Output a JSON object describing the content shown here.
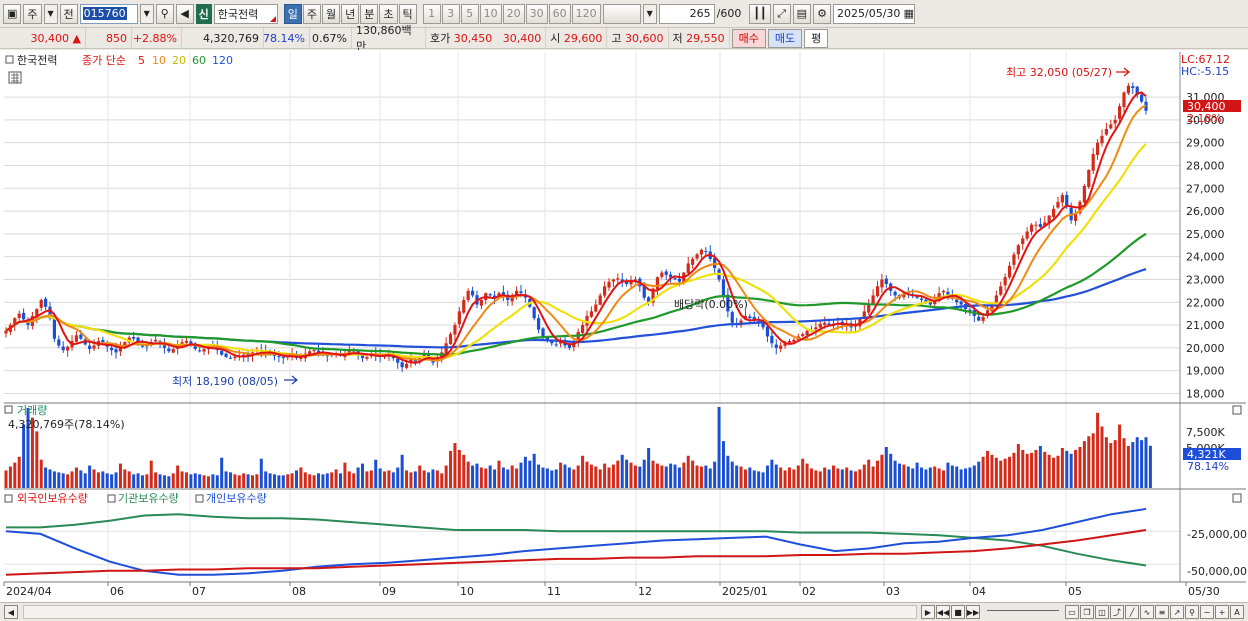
{
  "toolbar": {
    "period_main": "주",
    "market": "전",
    "code": "015760",
    "new_badge": "신",
    "stock_name": "한국전력",
    "periods": [
      "일",
      "주",
      "월",
      "년",
      "분",
      "초",
      "틱"
    ],
    "intervals": [
      "1",
      "3",
      "5",
      "10",
      "20",
      "30",
      "60",
      "120"
    ],
    "count": "265",
    "count_max": "/600",
    "date": "2025/05/30"
  },
  "quote": {
    "price": "30,400",
    "arrow": "▲",
    "change": "850",
    "change_pct": "+2.88%",
    "volume": "4,320,769",
    "volume_ratio": "78.14%",
    "turnover": "0.67%",
    "amount": "130,860백만",
    "hoga_label": "호가",
    "ask": "30,450",
    "bid": "30,400",
    "open_label": "시",
    "open": "29,600",
    "high_label": "고",
    "high": "30,600",
    "low_label": "저",
    "low": "29,550",
    "buy_label": "매수",
    "sell_label": "매도",
    "flat_label": "평"
  },
  "legend": {
    "stock": "한국전력",
    "type": "종가 단순",
    "ma": [
      "5",
      "10",
      "20",
      "60",
      "120"
    ],
    "lc": "LC:67.12",
    "hc": "HC:-5.15"
  },
  "annotations": {
    "high": "최고 32,050 (05/27)",
    "low": "최저 18,190 (08/05)",
    "dividend": "배당락(0.00%)"
  },
  "price_tag": "30,400",
  "price_pct": "2.18%",
  "volume_panel": {
    "title": "거래량",
    "value": "4,320,769주(78.14%)",
    "axis": [
      "7,500K",
      "5,000K"
    ],
    "tag": "4,321K",
    "tag_pct": "78.14%"
  },
  "holding_panel": {
    "legend": [
      "외국인보유수량",
      "기관보유수량",
      "개인보유수량"
    ],
    "axis": [
      "-25,000,00",
      "-50,000,00"
    ]
  },
  "x_labels": [
    "2024/04",
    "06",
    "07",
    "08",
    "09",
    "10",
    "11",
    "12",
    "2025/01",
    "02",
    "03",
    "04",
    "05",
    "05/30"
  ],
  "colors": {
    "up": "#d42a1a",
    "down": "#1b4fd3",
    "ma5": "#e01414",
    "ma10": "#ef8a12",
    "ma20": "#f0e010",
    "ma60": "#1f9a2a",
    "ma120": "#2250d8",
    "foreign": "#d01515",
    "institution": "#2a8a55",
    "individual": "#1f4fd8"
  },
  "chart_data": {
    "type": "candlestick",
    "title": "한국전력",
    "y_axis": [
      "31,000",
      "30,000",
      "29,000",
      "28,000",
      "27,000",
      "26,000",
      "25,000",
      "24,000",
      "23,000",
      "22,000",
      "21,000",
      "20,000",
      "19,000",
      "18,000"
    ],
    "ylim": [
      17800,
      32100
    ],
    "x_start": "2024/04",
    "x_end": "2025/05/30",
    "close_series": [
      20750,
      21000,
      21300,
      21500,
      21250,
      21000,
      21400,
      21700,
      22100,
      21800,
      21300,
      20400,
      20100,
      19900,
      20050,
      20300,
      20550,
      20400,
      20150,
      19950,
      20100,
      20300,
      20250,
      20050,
      19900,
      19800,
      20050,
      20250,
      20450,
      20400,
      20200,
      20050,
      20100,
      20250,
      20350,
      20200,
      20000,
      19850,
      19950,
      20100,
      20250,
      20300,
      20150,
      19950,
      19850,
      19950,
      20100,
      20050,
      19900,
      19700,
      19600,
      19550,
      19600,
      19650,
      19700,
      19650,
      19800,
      19900,
      19850,
      19750,
      19700,
      19650,
      19600,
      19550,
      19650,
      19700,
      19550,
      19600,
      19750,
      19850,
      19900,
      19800,
      19700,
      19650,
      19700,
      19750,
      19650,
      19700,
      19850,
      19900,
      19700,
      19550,
      19600,
      19750,
      19700,
      19600,
      19650,
      19700,
      19550,
      19350,
      19150,
      19300,
      19500,
      19400,
      19600,
      19700,
      19600,
      19350,
      19500,
      19800,
      20200,
      20600,
      21000,
      21600,
      22100,
      22500,
      22300,
      21900,
      22100,
      22400,
      22300,
      22200,
      22400,
      22300,
      22100,
      22300,
      22500,
      22400,
      22200,
      21800,
      21300,
      20800,
      20500,
      20300,
      20200,
      20150,
      20300,
      20100,
      20000,
      20300,
      20700,
      21000,
      21400,
      21600,
      21900,
      22300,
      22700,
      22900,
      23000,
      23050,
      22900,
      22800,
      22900,
      23000,
      22700,
      22200,
      22000,
      22600,
      23100,
      23300,
      23200,
      23100,
      23000,
      22900,
      23300,
      23700,
      23900,
      24100,
      24300,
      24200,
      23900,
      23500,
      23000,
      22300,
      21600,
      21100,
      21000,
      21200,
      21400,
      21300,
      21200,
      21100,
      20900,
      20500,
      20200,
      20000,
      20100,
      20250,
      20300,
      20350,
      20500,
      20600,
      20750,
      20800,
      20900,
      21050,
      21100,
      21000,
      21050,
      21100,
      21000,
      21050,
      20900,
      21000,
      21300,
      21600,
      21900,
      22300,
      22700,
      23000,
      22800,
      22500,
      22300,
      22200,
      22400,
      22350,
      22300,
      22200,
      22100,
      22000,
      21900,
      22100,
      22400,
      22500,
      22300,
      22150,
      22000,
      21900,
      21700,
      21600,
      21400,
      21200,
      21350,
      21650,
      21950,
      22300,
      22700,
      23100,
      23600,
      24100,
      24500,
      24800,
      25100,
      25400,
      25400,
      25300,
      25500,
      25800,
      26100,
      26400,
      26700,
      26200,
      25600,
      25900,
      26400,
      27100,
      27800,
      28500,
      29000,
      29300,
      29600,
      29800,
      30000,
      30600,
      31200,
      31500,
      31400,
      31100,
      30800,
      30400
    ],
    "volume_k": [
      1800,
      2200,
      2600,
      3200,
      6500,
      8200,
      7200,
      5800,
      2900,
      2100,
      1900,
      1700,
      1600,
      1500,
      1400,
      1700,
      2100,
      1800,
      1500,
      2300,
      1900,
      1600,
      1700,
      1500,
      1400,
      1600,
      2500,
      1900,
      1700,
      1400,
      1500,
      1300,
      1400,
      2800,
      1600,
      1400,
      1300,
      1200,
      1500,
      2300,
      1700,
      1600,
      1400,
      1500,
      1400,
      1300,
      1200,
      1400,
      1300,
      3100,
      1700,
      1600,
      1400,
      1300,
      1500,
      1400,
      1300,
      1400,
      3000,
      1700,
      1500,
      1400,
      1300,
      1300,
      1400,
      1500,
      1800,
      2100,
      1600,
      1400,
      1300,
      1500,
      1400,
      1500,
      1600,
      1900,
      1500,
      2600,
      1700,
      1500,
      2100,
      2500,
      1700,
      1800,
      2900,
      2000,
      1700,
      1800,
      1600,
      2100,
      3400,
      1800,
      1600,
      1700,
      2300,
      1800,
      1600,
      1900,
      1800,
      1500,
      2300,
      3800,
      4600,
      3900,
      3400,
      2700,
      2300,
      2500,
      2100,
      2000,
      2300,
      1900,
      2800,
      2100,
      1900,
      2300,
      2000,
      2600,
      3200,
      2800,
      3500,
      2400,
      2100,
      2000,
      1800,
      1900,
      2600,
      2400,
      2100,
      1900,
      2300,
      3300,
      2700,
      2400,
      2200,
      1900,
      2500,
      2100,
      2400,
      2800,
      3400,
      2900,
      2600,
      2300,
      2200,
      2900,
      4100,
      2800,
      2500,
      2300,
      2200,
      2500,
      2400,
      2100,
      2600,
      3300,
      2800,
      2300,
      2200,
      2300,
      2000,
      2700,
      8300,
      4800,
      3300,
      2700,
      2300,
      2200,
      1900,
      2100,
      1800,
      1700,
      1600,
      2300,
      2900,
      2400,
      2100,
      1800,
      2100,
      1900,
      2300,
      3000,
      2500,
      2000,
      1800,
      1700,
      2100,
      1900,
      2300,
      2000,
      1900,
      2100,
      1800,
      1700,
      1900,
      2400,
      2900,
      2200,
      2800,
      3400,
      4200,
      3500,
      2800,
      2500,
      2400,
      2200,
      2000,
      2600,
      2100,
      1900,
      2100,
      2200,
      2000,
      1800,
      2600,
      2300,
      2200,
      1900,
      2000,
      2100,
      2300,
      2700,
      3200,
      3800,
      3400,
      3100,
      2800,
      3000,
      3200,
      3600,
      4500,
      3900,
      3500,
      3600,
      3900,
      4300,
      3700,
      3400,
      3100,
      3300,
      4100,
      3800,
      3500,
      3900,
      4200,
      4800,
      5300,
      5600,
      7700,
      6300,
      5200,
      4600,
      4900,
      6500,
      5100,
      4300,
      4700,
      5200,
      4900,
      5200,
      4321
    ],
    "holding_million": {
      "foreign": [
        -58,
        -57,
        -56,
        -55,
        -55,
        -54,
        -54,
        -53,
        -53,
        -53,
        -52,
        -51,
        -50,
        -49,
        -48,
        -47,
        -46,
        -46,
        -45,
        -45,
        -44,
        -44,
        -44,
        -43,
        -43,
        -42,
        -42,
        -41,
        -40,
        -38,
        -35,
        -32,
        -28,
        -24
      ],
      "institution": [
        -22,
        -22,
        -20,
        -17,
        -13,
        -12,
        -14,
        -15,
        -15,
        -16,
        -18,
        -20,
        -22,
        -24,
        -24,
        -24,
        -25,
        -25,
        -25,
        -25,
        -25,
        -25,
        -25,
        -26,
        -26,
        -26,
        -27,
        -28,
        -30,
        -32,
        -36,
        -42,
        -47,
        -51
      ],
      "individual": [
        -25,
        -27,
        -38,
        -48,
        -55,
        -58,
        -58,
        -57,
        -55,
        -52,
        -50,
        -49,
        -47,
        -45,
        -43,
        -40,
        -38,
        -36,
        -34,
        -32,
        -31,
        -30,
        -29,
        -35,
        -40,
        -38,
        -34,
        -33,
        -30,
        -28,
        -24,
        -18,
        -12,
        -8
      ]
    }
  }
}
